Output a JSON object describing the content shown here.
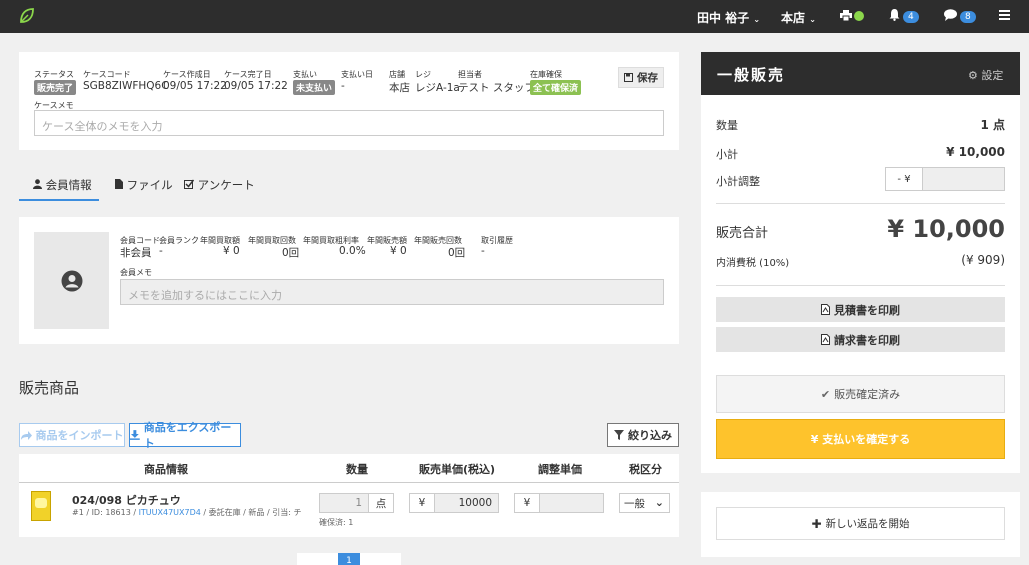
{
  "topbar": {
    "user": "田中 裕子",
    "store": "本店",
    "notifications": "4",
    "messages": "8"
  },
  "case": {
    "status_label": "ステータス",
    "status_value": "販売完了",
    "code_label": "ケースコード",
    "code_value": "SGB8ZIWFHQ6C",
    "created_label": "ケース作成日",
    "created_value": "09/05 17:22",
    "completed_label": "ケース完了日",
    "completed_value": "09/05 17:22",
    "payment_label": "支払い",
    "payment_value": "未支払い",
    "paydate_label": "支払い日",
    "paydate_value": "-",
    "store_label": "店舗",
    "store_value": "本店",
    "register_label": "レジ",
    "register_value": "レジA-1a",
    "staff_label": "担当者",
    "staff_value": "テスト スタッフ",
    "stock_label": "在庫確保",
    "stock_value": "全て確保済",
    "save_label": "保存",
    "memo_label": "ケースメモ",
    "memo_placeholder": "ケース全体のメモを入力"
  },
  "tabs": [
    "会員情報",
    "ファイル",
    "アンケート"
  ],
  "member": {
    "code_label": "会員コード",
    "code_value": "非会員",
    "rank_label": "会員ランク",
    "rank_value": "-",
    "buy_amount_label": "年間買取額",
    "buy_amount_value": "¥ 0",
    "buy_count_label": "年間買取回数",
    "buy_count_value": "0回",
    "margin_label": "年間買取粗利率",
    "margin_value": "0.0%",
    "sale_amount_label": "年間販売額",
    "sale_amount_value": "¥ 0",
    "sale_count_label": "年間販売回数",
    "sale_count_value": "0回",
    "history_label": "取引履歴",
    "history_value": "-",
    "memo_label": "会員メモ",
    "memo_placeholder": "メモを追加するにはここに入力"
  },
  "products": {
    "title": "販売商品",
    "import_label": "商品をインポート",
    "export_label": "商品をエクスポート",
    "filter_label": "絞り込み",
    "headers": [
      "商品情報",
      "数量",
      "販売単価(税込)",
      "調整単価",
      "税区分"
    ],
    "rows": [
      {
        "name": "024/098 ピカチュウ",
        "meta_prefix": "#1 / ID: 18613 / ",
        "meta_link": "ITUUX47UX7D4",
        "meta_suffix": " / 委託在庫 / 新品 / 引当: チ...",
        "qty": "1",
        "unit": "点",
        "reserved": "確保済: 1",
        "currency": "¥",
        "price": "10000",
        "adj_currency": "¥",
        "tax": "一般"
      }
    ],
    "page": "1"
  },
  "sale": {
    "title": "一般販売",
    "settings_label": "設定",
    "qty_label": "数量",
    "qty_value": "1 点",
    "subtotal_label": "小計",
    "subtotal_value": "¥ 10,000",
    "adjust_label": "小計調整",
    "adjust_prefix": "- ¥",
    "total_label": "販売合計",
    "total_value": "¥ 10,000",
    "tax_label": "内消費税 (10%)",
    "tax_value": "(¥ 909)",
    "estimate_label": "見積書を印刷",
    "invoice_label": "請求書を印刷",
    "confirmed_label": "販売確定済み",
    "pay_label": "¥ 支払いを確定する",
    "return_label": "新しい返品を開始"
  }
}
